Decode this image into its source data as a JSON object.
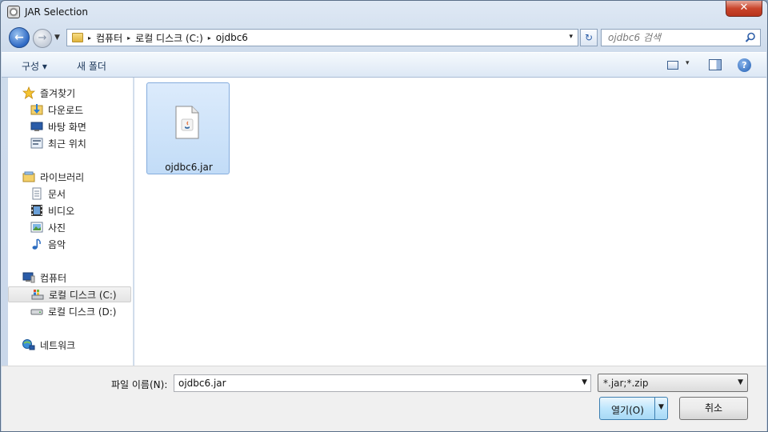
{
  "window": {
    "title": "JAR Selection",
    "close_label": "✕"
  },
  "address": {
    "crumbs": [
      "컴퓨터",
      "로컬 디스크 (C:)",
      "ojdbc6"
    ],
    "separator": "▸",
    "dropdown_glyph": "▾"
  },
  "search": {
    "placeholder": "ojdbc6 검색"
  },
  "toolbar": {
    "organize_label": "구성 ▾",
    "new_folder_label": "새 폴더",
    "view_drop": "▾",
    "help": "?"
  },
  "nav": {
    "favorites": {
      "label": "즐겨찾기",
      "items": [
        "다운로드",
        "바탕 화면",
        "최근 위치"
      ]
    },
    "libraries": {
      "label": "라이브러리",
      "items": [
        "문서",
        "비디오",
        "사진",
        "음악"
      ]
    },
    "computer": {
      "label": "컴퓨터",
      "items": [
        "로컬 디스크 (C:)",
        "로컬 디스크 (D:)"
      ]
    },
    "network": {
      "label": "네트워크"
    }
  },
  "files": [
    {
      "name": "ojdbc6.jar",
      "icon": "jar-file-icon",
      "selected": true
    }
  ],
  "footer": {
    "file_name_label": "파일 이름(N):",
    "file_name_value": "ojdbc6.jar",
    "filter_value": "*.jar;*.zip",
    "open_label": "열기(O)",
    "cancel_label": "취소"
  },
  "colors": {
    "selection": "#cce4fc",
    "accent": "#3c7fb1",
    "close": "#c9452c"
  }
}
